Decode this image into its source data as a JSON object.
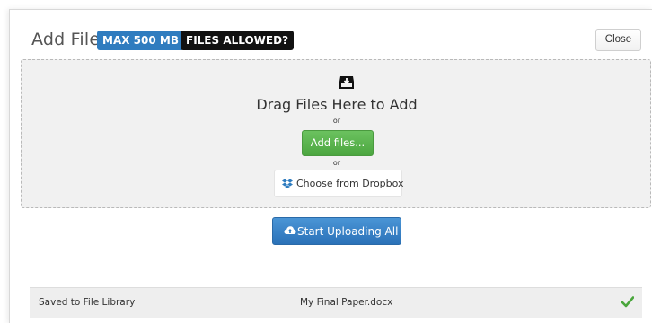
{
  "modal": {
    "title": "Add File",
    "max_badge": "MAX 500 MB",
    "files_allowed_badge": "FILES ALLOWED?",
    "close_label": "Close"
  },
  "dropzone": {
    "icon": "tray-download-icon",
    "title": "Drag Files Here to Add",
    "or_1": "or",
    "add_files_label": "Add files...",
    "or_2": "or",
    "dropbox_icon": "dropbox-icon",
    "dropbox_label": "Choose from Dropbox"
  },
  "upload": {
    "icon": "cloud-upload-icon",
    "start_label": "Start Uploading All"
  },
  "files": [
    {
      "status": "Saved to File Library",
      "name": "My Final Paper.docx",
      "status_icon": "checkmark-icon"
    }
  ],
  "colors": {
    "badge_blue": "#2f7cbf",
    "badge_black": "#111111",
    "add_files_green": "#5cb54f",
    "start_blue": "#3a84c8",
    "check_green": "#4aa63c",
    "dropzone_bg": "#f1f1f1"
  }
}
